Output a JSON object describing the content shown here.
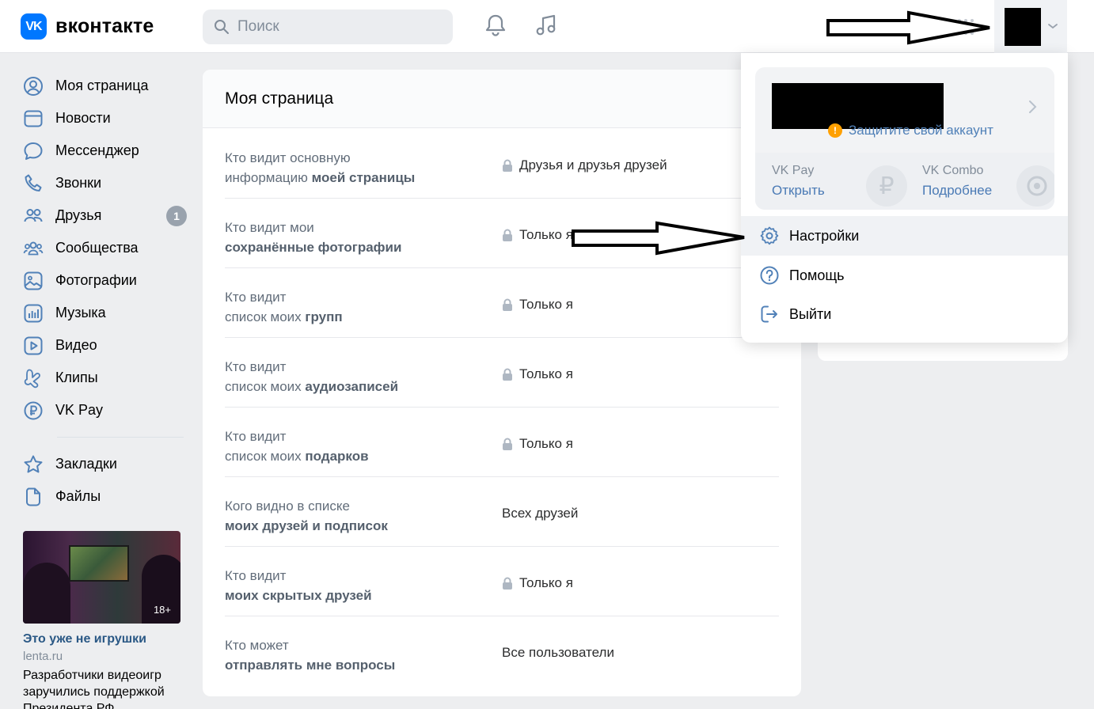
{
  "header": {
    "logo_mark": "VK",
    "logo_text": "вконтакте",
    "search_placeholder": "Поиск"
  },
  "sidebar": {
    "items": [
      {
        "label": "Моя страница",
        "icon": "user-circle-icon"
      },
      {
        "label": "Новости",
        "icon": "newsfeed-icon"
      },
      {
        "label": "Мессенджер",
        "icon": "message-icon"
      },
      {
        "label": "Звонки",
        "icon": "phone-icon"
      },
      {
        "label": "Друзья",
        "icon": "users-icon",
        "badge": "1"
      },
      {
        "label": "Сообщества",
        "icon": "community-icon"
      },
      {
        "label": "Фотографии",
        "icon": "photo-icon"
      },
      {
        "label": "Музыка",
        "icon": "music-icon"
      },
      {
        "label": "Видео",
        "icon": "video-icon"
      },
      {
        "label": "Клипы",
        "icon": "clips-icon"
      },
      {
        "label": "VK Pay",
        "icon": "ruble-icon"
      }
    ],
    "extra_items": [
      {
        "label": "Закладки",
        "icon": "star-icon"
      },
      {
        "label": "Файлы",
        "icon": "file-icon"
      }
    ],
    "ad": {
      "age": "18+",
      "title": "Это уже не игрушки",
      "source": "lenta.ru",
      "text": "Разработчики видеоигр заручились поддержкой Президента РФ"
    }
  },
  "main": {
    "title": "Моя страница",
    "rows": [
      {
        "q1": "Кто видит основную",
        "q2_plain": "информацию ",
        "q2_bold": "моей страницы",
        "value": "Друзья и друзья друзей",
        "locked": true
      },
      {
        "q1": "Кто видит мои",
        "q2_plain": "",
        "q2_bold": "сохранённые фотографии",
        "value": "Только я",
        "locked": true
      },
      {
        "q1": "Кто видит",
        "q2_plain": "список моих ",
        "q2_bold": "групп",
        "value": "Только я",
        "locked": true
      },
      {
        "q1": "Кто видит",
        "q2_plain": "список моих ",
        "q2_bold": "аудиозаписей",
        "value": "Только я",
        "locked": true
      },
      {
        "q1": "Кто видит",
        "q2_plain": "список моих ",
        "q2_bold": "подарков",
        "value": "Только я",
        "locked": true
      },
      {
        "q1": "Кого видно в списке",
        "q2_plain": "",
        "q2_bold": "моих друзей и подписок",
        "value": "Всех друзей",
        "locked": false
      },
      {
        "q1": "Кто видит",
        "q2_plain": "",
        "q2_bold": "моих скрытых друзей",
        "value": "Только я",
        "locked": true
      },
      {
        "q1": "Кто может",
        "q2_plain": "",
        "q2_bold": "отправлять мне вопросы",
        "value": "Все пользователи",
        "locked": false
      }
    ]
  },
  "dropdown": {
    "protect_text": "Защитите свой аккаунт",
    "vkpay": {
      "name": "VK Pay",
      "link": "Открыть"
    },
    "vkcombo": {
      "name": "VK Combo",
      "link": "Подробнее"
    },
    "menu": [
      {
        "label": "Настройки",
        "icon": "gear-icon"
      },
      {
        "label": "Помощь",
        "icon": "help-icon"
      },
      {
        "label": "Выйти",
        "icon": "logout-icon"
      }
    ]
  }
}
